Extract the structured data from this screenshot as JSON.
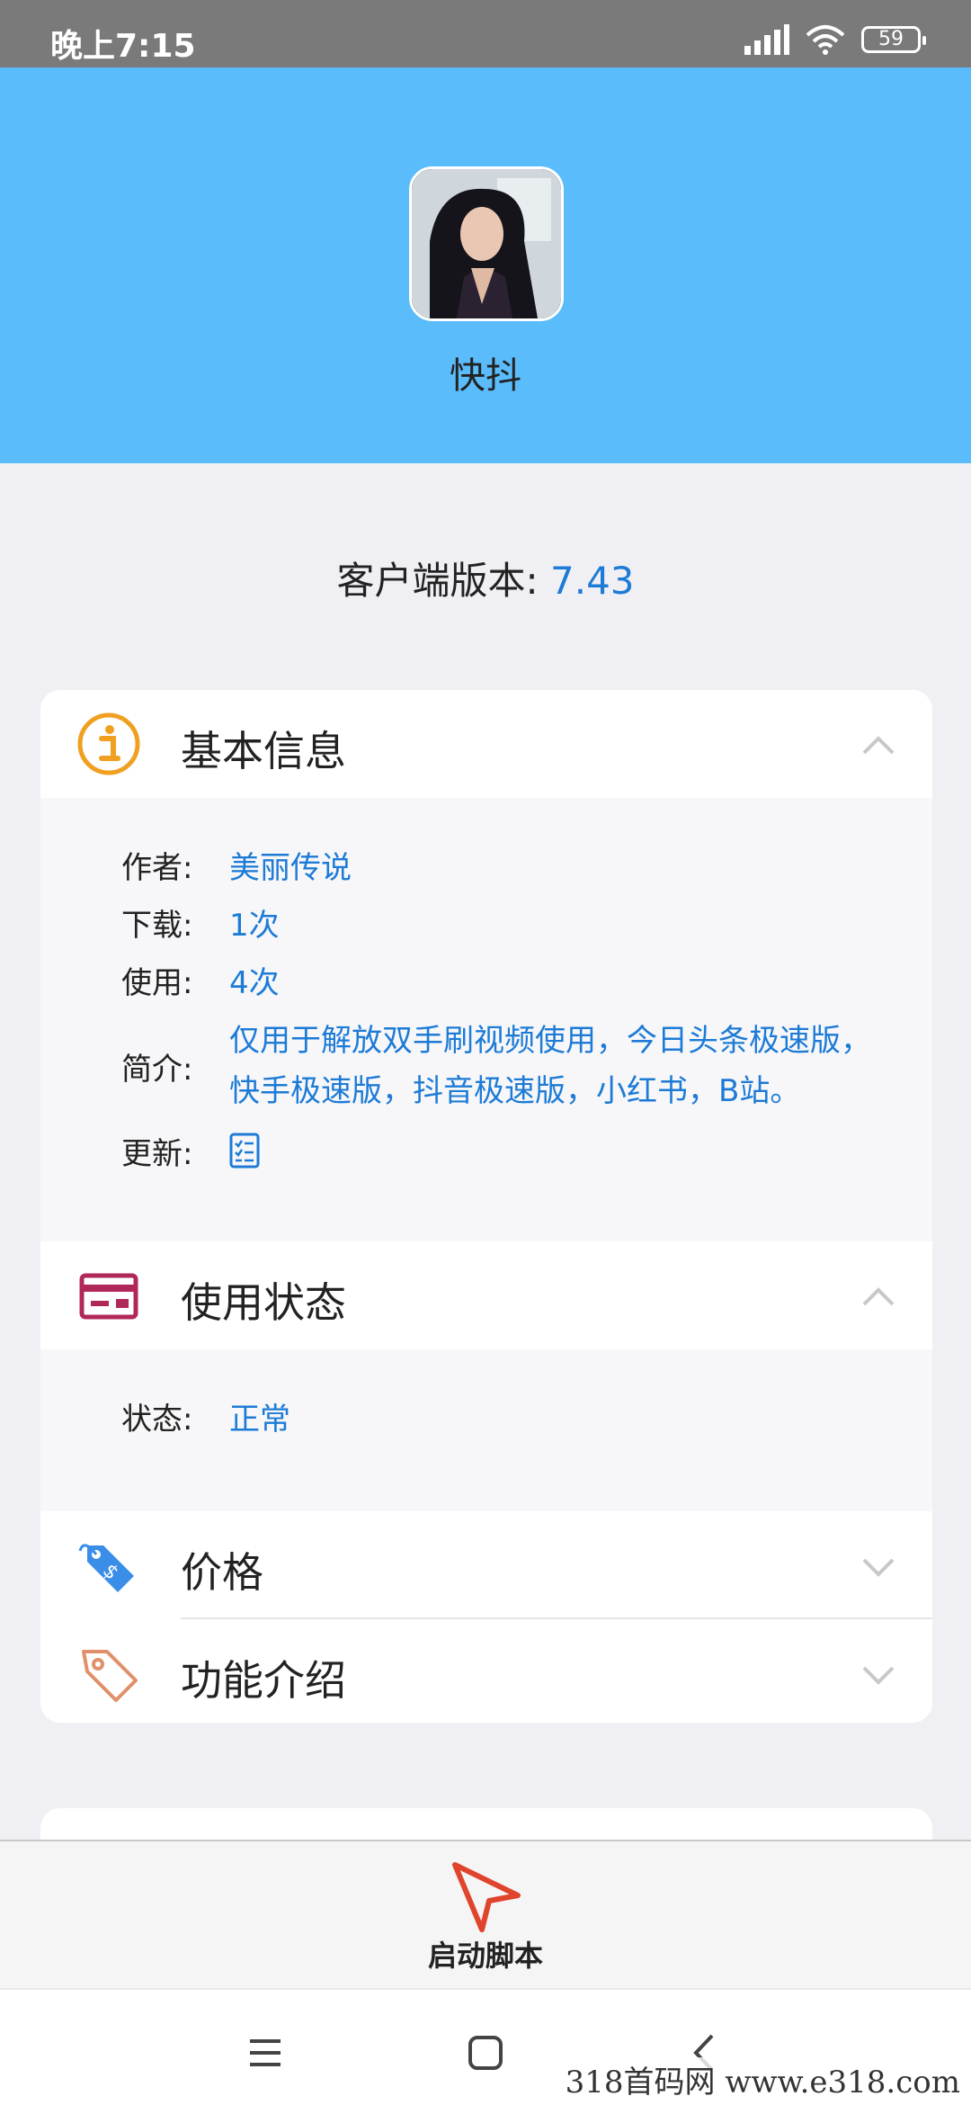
{
  "status_bar": {
    "time": "晚上7:15",
    "battery": "59"
  },
  "header": {
    "app_name": "快抖",
    "avatar_icon": "user-avatar-photo"
  },
  "version": {
    "label": "客户端版本: ",
    "value": "7.43"
  },
  "sections": {
    "basic_info": {
      "title": "基本信息",
      "icon": "info-icon",
      "expanded": true,
      "rows": {
        "author": {
          "key": "作者:",
          "value": "美丽传说"
        },
        "downloads": {
          "key": "下载:",
          "value": "1次"
        },
        "uses": {
          "key": "使用:",
          "value": "4次"
        },
        "intro": {
          "key": "简介:",
          "value": "仅用于解放双手刷视频使用，今日头条极速版，快手极速版，抖音极速版，小红书，B站。"
        },
        "update": {
          "key": "更新:",
          "icon": "changelog-icon"
        }
      }
    },
    "usage_status": {
      "title": "使用状态",
      "icon": "card-icon",
      "expanded": true,
      "rows": {
        "status": {
          "key": "状态:",
          "value": "正常"
        }
      }
    },
    "price": {
      "title": "价格",
      "icon": "price-tag-icon",
      "expanded": false
    },
    "features": {
      "title": "功能介绍",
      "icon": "tag-icon",
      "expanded": false
    }
  },
  "action": {
    "label": "启动脚本",
    "icon": "cursor-arrow-icon"
  },
  "watermark": "318首码网  www.e318.com",
  "colors": {
    "header": "#5bbcfc",
    "accent_blue": "#1d7bd6",
    "info_orange": "#f0a020",
    "card_red": "#b0285a",
    "arrow_red": "#e0442c"
  }
}
